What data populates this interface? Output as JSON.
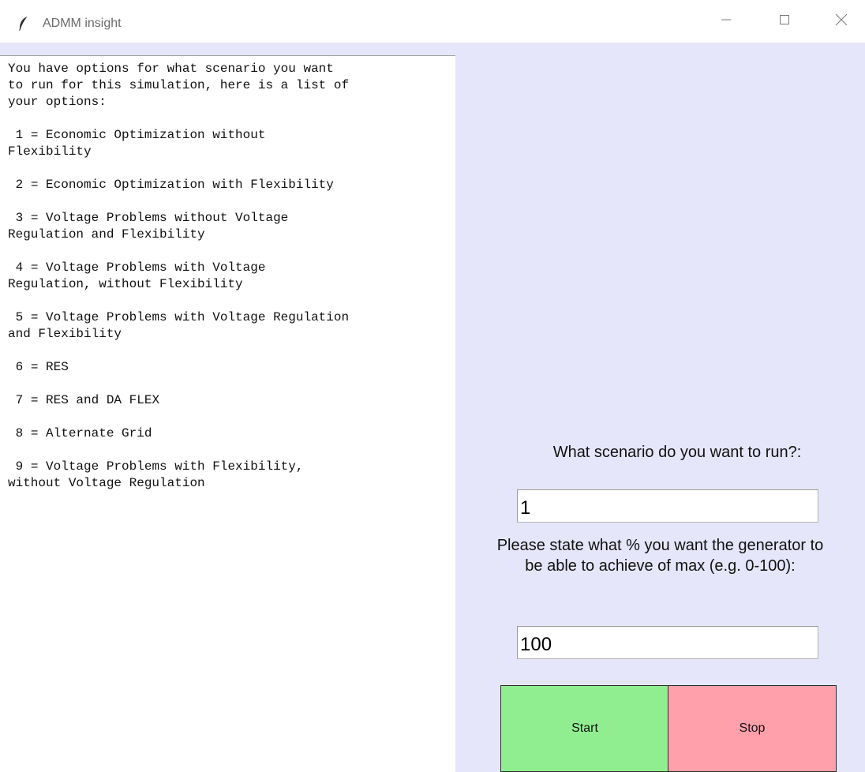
{
  "window": {
    "title": "ADMM insight"
  },
  "titlebar_icons": {
    "app": "feather-icon",
    "minimize": "minimize-icon",
    "maximize": "maximize-icon",
    "close": "close-icon"
  },
  "text_panel": {
    "content": "You have options for what scenario you want\nto run for this simulation, here is a list of\nyour options:\n\n 1 = Economic Optimization without\nFlexibility\n\n 2 = Economic Optimization with Flexibility\n\n 3 = Voltage Problems without Voltage\nRegulation and Flexibility\n\n 4 = Voltage Problems with Voltage\nRegulation, without Flexibility\n\n 5 = Voltage Problems with Voltage Regulation\nand Flexibility\n\n 6 = RES\n\n 7 = RES and DA FLEX\n\n 8 = Alternate Grid\n\n 9 = Voltage Problems with Flexibility,\nwithout Voltage Regulation"
  },
  "form": {
    "scenario_label": "What scenario do you want to run?:",
    "scenario_value": "1",
    "percent_label_line1": "Please state what % you want the generator to",
    "percent_label_line2": "be able to achieve of max (e.g. 0-100):",
    "percent_value": "100",
    "start_label": "Start",
    "stop_label": "Stop"
  },
  "colors": {
    "window_bg": "#e6e6fa",
    "start_bg": "#90ee90",
    "stop_bg": "#ffa0ab"
  }
}
